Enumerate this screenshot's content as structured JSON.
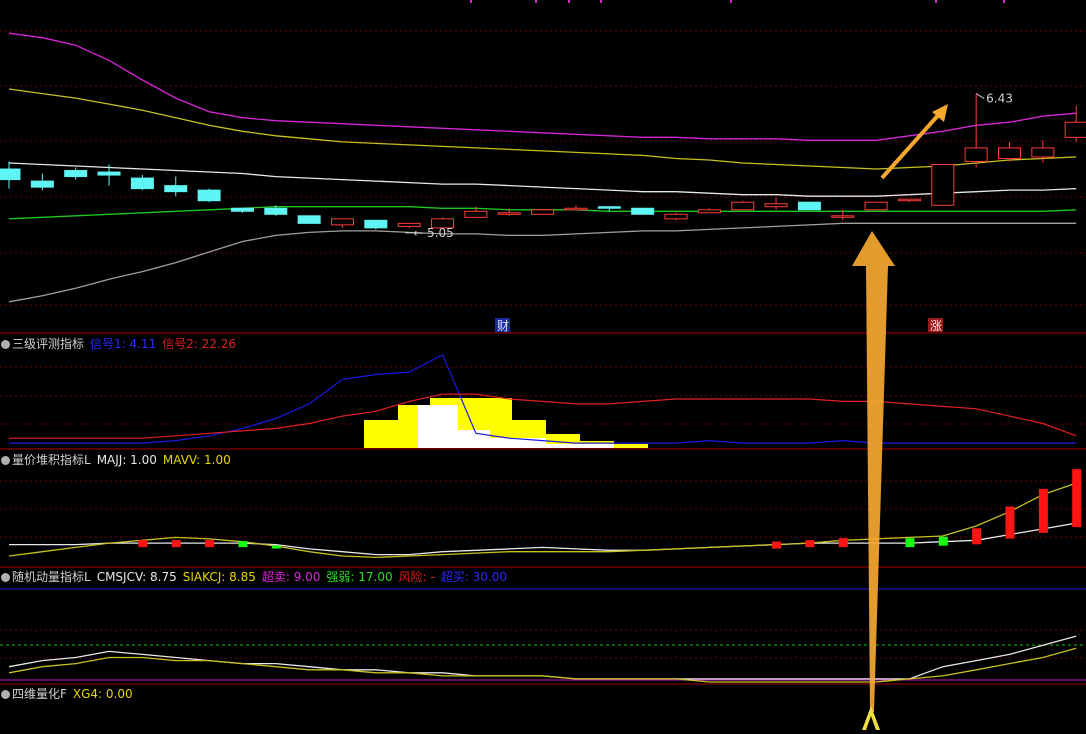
{
  "colors": {
    "background": "#000000",
    "divider": "#a00000",
    "grid": "#6a0000",
    "up": "#ff3b3b",
    "down": "#5ff5f5",
    "magenta": "#d626d6",
    "olive": "#c8c020",
    "white": "#e8e8e8",
    "green": "#1fc81f",
    "gray": "#a0a0a0",
    "blue": "#1a1ae6",
    "red": "#e02020",
    "yellow": "#ffff00",
    "arrow": "#f5a830"
  },
  "price_panel": {
    "high_label": "6.43",
    "low_label": "5.05",
    "marker_cai": "财",
    "marker_zhang": "涨"
  },
  "panel2": {
    "title": "三级评测指标",
    "sig1": "信号1: 4.11",
    "sig2": "信号2: 22.26"
  },
  "panel3": {
    "title": "量价堆积指标L",
    "majj": "MAJJ: 1.00",
    "mavv": "MAVV: 1.00"
  },
  "panel4": {
    "title": "随机动量指标L",
    "cmsjcv": "CMSJCV: 8.75",
    "siakcj": "SIAKCJ: 8.85",
    "chaomai": "超卖: 9.00",
    "qiangruo": "强弱: 17.00",
    "fengxian": "风险: -",
    "chaomai2": "超买: 30.00"
  },
  "panel5": {
    "title": "四维量化F",
    "xg4": "XG4: 0.00"
  },
  "chart_data": [
    {
      "type": "candlestick",
      "title": "",
      "candles": [
        {
          "o": 5.93,
          "c": 5.86,
          "h": 5.98,
          "l": 5.8
        },
        {
          "o": 5.85,
          "c": 5.81,
          "h": 5.9,
          "l": 5.79
        },
        {
          "o": 5.92,
          "c": 5.88,
          "h": 5.94,
          "l": 5.86
        },
        {
          "o": 5.91,
          "c": 5.89,
          "h": 5.96,
          "l": 5.82
        },
        {
          "o": 5.87,
          "c": 5.8,
          "h": 5.89,
          "l": 5.79
        },
        {
          "o": 5.82,
          "c": 5.78,
          "h": 5.88,
          "l": 5.75
        },
        {
          "o": 5.79,
          "c": 5.72,
          "h": 5.8,
          "l": 5.71
        },
        {
          "o": 5.67,
          "c": 5.65,
          "h": 5.67,
          "l": 5.64
        },
        {
          "o": 5.67,
          "c": 5.63,
          "h": 5.69,
          "l": 5.62
        },
        {
          "o": 5.62,
          "c": 5.57,
          "h": 5.62,
          "l": 5.57
        },
        {
          "o": 5.56,
          "c": 5.6,
          "h": 5.6,
          "l": 5.54
        },
        {
          "o": 5.59,
          "c": 5.54,
          "h": 5.59,
          "l": 5.53
        },
        {
          "o": 5.55,
          "c": 5.57,
          "h": 5.57,
          "l": 5.54
        },
        {
          "o": 5.54,
          "c": 5.6,
          "h": 5.61,
          "l": 5.54
        },
        {
          "o": 5.61,
          "c": 5.65,
          "h": 5.68,
          "l": 5.61
        },
        {
          "o": 5.64,
          "c": 5.64,
          "h": 5.67,
          "l": 5.62
        },
        {
          "o": 5.63,
          "c": 5.66,
          "h": 5.66,
          "l": 5.63
        },
        {
          "o": 5.66,
          "c": 5.67,
          "h": 5.69,
          "l": 5.66
        },
        {
          "o": 5.68,
          "c": 5.67,
          "h": 5.68,
          "l": 5.65
        },
        {
          "o": 5.67,
          "c": 5.63,
          "h": 5.67,
          "l": 5.63
        },
        {
          "o": 5.6,
          "c": 5.63,
          "h": 5.64,
          "l": 5.59
        },
        {
          "o": 5.64,
          "c": 5.66,
          "h": 5.67,
          "l": 5.64
        },
        {
          "o": 5.66,
          "c": 5.71,
          "h": 5.72,
          "l": 5.66
        },
        {
          "o": 5.68,
          "c": 5.7,
          "h": 5.74,
          "l": 5.66
        },
        {
          "o": 5.71,
          "c": 5.66,
          "h": 5.71,
          "l": 5.66
        },
        {
          "o": 5.62,
          "c": 5.62,
          "h": 5.66,
          "l": 5.59
        },
        {
          "o": 5.66,
          "c": 5.71,
          "h": 5.71,
          "l": 5.66
        },
        {
          "o": 5.73,
          "c": 5.73,
          "h": 5.73,
          "l": 5.71
        },
        {
          "o": 5.69,
          "c": 5.96,
          "h": 5.96,
          "l": 5.69
        },
        {
          "o": 5.98,
          "c": 6.07,
          "h": 6.43,
          "l": 5.94
        },
        {
          "o": 6.0,
          "c": 6.07,
          "h": 6.11,
          "l": 5.98
        },
        {
          "o": 6.01,
          "c": 6.07,
          "h": 6.12,
          "l": 5.97
        },
        {
          "o": 6.14,
          "c": 6.24,
          "h": 6.35,
          "l": 6.11
        }
      ],
      "lines": [
        {
          "name": "",
          "color": "magenta",
          "values": [
            6.83,
            6.8,
            6.75,
            6.65,
            6.52,
            6.4,
            6.31,
            6.27,
            6.25,
            6.24,
            6.23,
            6.22,
            6.21,
            6.2,
            6.19,
            6.18,
            6.17,
            6.16,
            6.15,
            6.14,
            6.14,
            6.13,
            6.13,
            6.13,
            6.12,
            6.12,
            6.12,
            6.15,
            6.18,
            6.22,
            6.24,
            6.28,
            6.3
          ]
        },
        {
          "name": "",
          "color": "olive",
          "values": [
            6.46,
            6.43,
            6.4,
            6.36,
            6.32,
            6.27,
            6.22,
            6.18,
            6.15,
            6.13,
            6.11,
            6.1,
            6.09,
            6.08,
            6.07,
            6.06,
            6.05,
            6.04,
            6.03,
            6.02,
            6.0,
            5.99,
            5.97,
            5.96,
            5.95,
            5.94,
            5.93,
            5.94,
            5.95,
            5.97,
            5.99,
            6.0,
            6.01
          ]
        },
        {
          "name": "",
          "color": "white",
          "values": [
            5.97,
            5.96,
            5.95,
            5.94,
            5.93,
            5.92,
            5.91,
            5.9,
            5.88,
            5.87,
            5.86,
            5.85,
            5.84,
            5.83,
            5.83,
            5.82,
            5.81,
            5.8,
            5.79,
            5.78,
            5.78,
            5.77,
            5.76,
            5.76,
            5.75,
            5.75,
            5.75,
            5.76,
            5.77,
            5.78,
            5.79,
            5.79,
            5.8
          ]
        },
        {
          "name": "",
          "color": "green",
          "values": [
            5.6,
            5.61,
            5.62,
            5.63,
            5.64,
            5.65,
            5.66,
            5.67,
            5.68,
            5.68,
            5.68,
            5.68,
            5.68,
            5.67,
            5.67,
            5.66,
            5.66,
            5.66,
            5.65,
            5.65,
            5.65,
            5.65,
            5.65,
            5.65,
            5.65,
            5.65,
            5.65,
            5.65,
            5.65,
            5.65,
            5.65,
            5.65,
            5.66
          ]
        },
        {
          "name": "",
          "color": "gray",
          "values": [
            5.05,
            5.09,
            5.14,
            5.2,
            5.25,
            5.31,
            5.38,
            5.45,
            5.49,
            5.51,
            5.52,
            5.52,
            5.51,
            5.5,
            5.5,
            5.49,
            5.49,
            5.5,
            5.51,
            5.52,
            5.52,
            5.53,
            5.54,
            5.55,
            5.56,
            5.57,
            5.57,
            5.57,
            5.57,
            5.57,
            5.57,
            5.57,
            5.57
          ]
        }
      ],
      "ylim": [
        4.85,
        7.05
      ]
    },
    {
      "type": "line",
      "title": "三级评测指标",
      "series": [
        {
          "name": "信号1",
          "color": "blue",
          "values": [
            2,
            2,
            2,
            2,
            2,
            3,
            5,
            8,
            12,
            18,
            28,
            30,
            31,
            38,
            6,
            4,
            3,
            2,
            2,
            2,
            2,
            3,
            2,
            2,
            2,
            3,
            2,
            2,
            2,
            2,
            2,
            2,
            2
          ]
        },
        {
          "name": "信号2",
          "color": "red",
          "values": [
            4,
            4,
            4,
            4,
            4,
            5,
            6,
            7,
            8,
            10,
            13,
            15,
            19,
            22,
            22,
            20,
            19,
            18,
            18,
            19,
            20,
            20,
            20,
            20,
            20,
            19,
            19,
            18,
            17,
            16,
            13,
            10,
            5
          ]
        }
      ],
      "ylim": [
        0,
        40
      ]
    },
    {
      "type": "line",
      "title": "量价堆积指标L",
      "series": [
        {
          "name": "MAJJ",
          "color": "white",
          "values": [
            0.45,
            0.45,
            0.45,
            0.46,
            0.46,
            0.46,
            0.46,
            0.46,
            0.45,
            0.42,
            0.4,
            0.38,
            0.38,
            0.4,
            0.41,
            0.42,
            0.43,
            0.42,
            0.41,
            0.41,
            0.42,
            0.43,
            0.44,
            0.45,
            0.46,
            0.46,
            0.46,
            0.46,
            0.47,
            0.48,
            0.52,
            0.56,
            0.6
          ]
        },
        {
          "name": "MAVV",
          "color": "olive",
          "values": [
            0.37,
            0.4,
            0.43,
            0.46,
            0.48,
            0.5,
            0.49,
            0.47,
            0.44,
            0.4,
            0.37,
            0.36,
            0.37,
            0.38,
            0.39,
            0.4,
            0.4,
            0.4,
            0.4,
            0.41,
            0.42,
            0.43,
            0.44,
            0.45,
            0.46,
            0.48,
            0.49,
            0.5,
            0.51,
            0.58,
            0.68,
            0.8,
            0.88
          ]
        }
      ],
      "bars": [
        0,
        0,
        0,
        0,
        1,
        1,
        1,
        -1,
        -1,
        0,
        0,
        0,
        0,
        0,
        0,
        0,
        0,
        0,
        0,
        0,
        0,
        0,
        0,
        1,
        1,
        1,
        0,
        -1,
        -1,
        1,
        1,
        1,
        1
      ],
      "ylim": [
        0.3,
        1.0
      ]
    },
    {
      "type": "line",
      "title": "随机动量指标L",
      "series": [
        {
          "name": "CMSJCV",
          "color": "white",
          "values": [
            5,
            7,
            8,
            10,
            9,
            8,
            7,
            6,
            6,
            5,
            4,
            4,
            3,
            3,
            2,
            2,
            2,
            1,
            1,
            1,
            1,
            1,
            1,
            1,
            1,
            1,
            1,
            1,
            5,
            7,
            9,
            12,
            15
          ]
        },
        {
          "name": "SIAKCJ",
          "color": "olive",
          "values": [
            3,
            5,
            6,
            8,
            8,
            7,
            7,
            6,
            5,
            4,
            4,
            3,
            3,
            2,
            2,
            2,
            2,
            1,
            1,
            1,
            1,
            0,
            0,
            0,
            0,
            0,
            0,
            1,
            2,
            4,
            6,
            8,
            11
          ]
        }
      ],
      "levels": {
        "超卖": 9.0,
        "强弱": 17.0,
        "超买": 30.0
      },
      "ylim": [
        0,
        32
      ]
    }
  ]
}
